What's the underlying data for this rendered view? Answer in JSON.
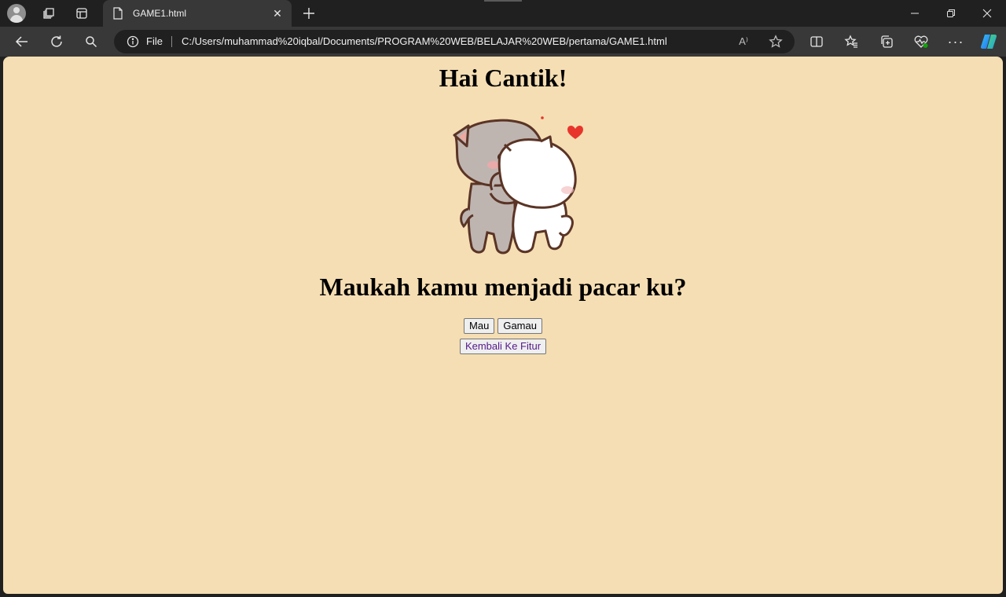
{
  "browser": {
    "tab": {
      "title": "GAME1.html"
    },
    "address": {
      "scheme_label": "File",
      "url": "C:/Users/muhammad%20iqbal/Documents/PROGRAM%20WEB/BELAJAR%20WEB/pertama/GAME1.html"
    },
    "read_aloud_label": "A⁾"
  },
  "page": {
    "title": "Hai Cantik!",
    "question": "Maukah kamu menjadi pacar ku?",
    "yes_button": "Mau",
    "no_button": "Gamau",
    "back_button": "Kembali Ke Fitur"
  },
  "colors": {
    "page_background": "#f5deb3",
    "browser_chrome": "#202020",
    "toolbar": "#383838",
    "link_text": "#551a8b"
  }
}
